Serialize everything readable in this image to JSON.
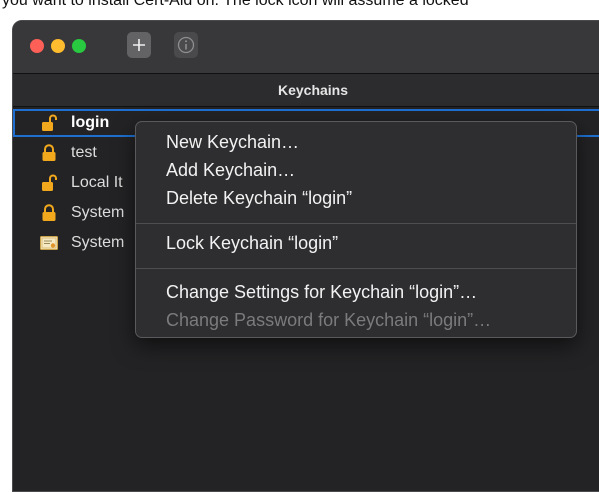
{
  "doc_text": "you want to install Cert-Aid on. The lock icon will assume a locked",
  "window": {
    "toolbar": {
      "add_icon": "plus-icon",
      "info_icon": "info-icon"
    },
    "header": "Keychains",
    "keychains": [
      {
        "label": "login",
        "icon": "lock-open-icon",
        "selected": true
      },
      {
        "label": "test",
        "icon": "lock-closed-icon",
        "selected": false
      },
      {
        "label": "Local It",
        "icon": "lock-open-icon",
        "selected": false
      },
      {
        "label": "System",
        "icon": "lock-closed-icon",
        "selected": false
      },
      {
        "label": "System",
        "icon": "certificate-icon",
        "selected": false
      }
    ]
  },
  "context_menu": {
    "items": [
      {
        "label": "New Keychain…",
        "enabled": true
      },
      {
        "label": "Add Keychain…",
        "enabled": true
      },
      {
        "label": "Delete Keychain “login”",
        "enabled": true
      },
      {
        "label": "Lock Keychain “login”",
        "enabled": true
      },
      {
        "label": "Change Settings for Keychain “login”…",
        "enabled": true
      },
      {
        "label": "Change Password for Keychain “login”…",
        "enabled": false
      }
    ]
  },
  "colors": {
    "selection": "#1f6fd1",
    "lock": "#f2a81d",
    "traffic_red": "#fe5f57",
    "traffic_yellow": "#febc2e",
    "traffic_green": "#28c840"
  }
}
